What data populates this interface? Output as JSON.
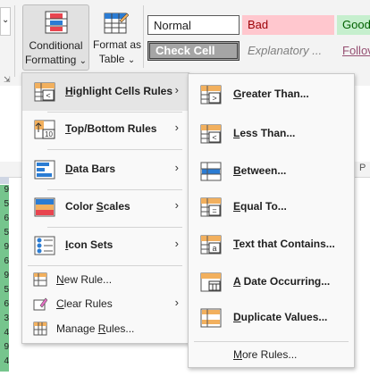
{
  "ribbon": {
    "conditional_formatting": {
      "line1": "Conditional",
      "line2": "Formatting",
      "arrow": "⌄"
    },
    "format_as_table": {
      "line1": "Format as",
      "line2": "Table",
      "arrow": "⌄"
    },
    "styles": {
      "normal": "Normal",
      "bad": "Bad",
      "good": "Good",
      "check_cell": "Check Cell",
      "explanatory": "Explanatory ...",
      "follow": "Follov"
    }
  },
  "sheet": {
    "row_values": [
      "9",
      "5",
      "6",
      "5",
      "9",
      "6",
      "9",
      "5",
      "6",
      "3",
      "4",
      "9",
      "4"
    ],
    "col_header_fragment": "P"
  },
  "main_menu": {
    "items": [
      {
        "prefix": "",
        "key": "H",
        "rest": "ighlight Cells Rules",
        "icon": "highlight-cells-rules-icon",
        "submenu": true
      },
      {
        "prefix": "",
        "key": "T",
        "rest": "op/Bottom Rules",
        "icon": "top-bottom-rules-icon",
        "submenu": true
      },
      {
        "prefix": "",
        "key": "D",
        "rest": "ata Bars",
        "icon": "data-bars-icon",
        "submenu": true
      },
      {
        "prefix": "Color ",
        "key": "S",
        "rest": "cales",
        "icon": "color-scales-icon",
        "submenu": true
      },
      {
        "prefix": "",
        "key": "I",
        "rest": "con Sets",
        "icon": "icon-sets-icon",
        "submenu": true
      }
    ],
    "small_items": [
      {
        "prefix": "",
        "key": "N",
        "rest": "ew Rule...",
        "icon": "new-rule-icon",
        "submenu": false
      },
      {
        "prefix": "",
        "key": "C",
        "rest": "lear Rules",
        "icon": "clear-rules-icon",
        "submenu": true
      },
      {
        "prefix": "Manage ",
        "key": "R",
        "rest": "ules...",
        "icon": "manage-rules-icon",
        "submenu": false
      }
    ],
    "arrow": "›"
  },
  "sub_menu": {
    "items": [
      {
        "prefix": "",
        "key": "G",
        "rest": "reater Than...",
        "icon": "greater-than-icon",
        "glyph": ">"
      },
      {
        "prefix": "",
        "key": "L",
        "rest": "ess Than...",
        "icon": "less-than-icon",
        "glyph": "<"
      },
      {
        "prefix": "",
        "key": "B",
        "rest": "etween...",
        "icon": "between-icon",
        "glyph": ""
      },
      {
        "prefix": "",
        "key": "E",
        "rest": "qual To...",
        "icon": "equal-to-icon",
        "glyph": "="
      },
      {
        "prefix": "",
        "key": "T",
        "rest": "ext that Contains...",
        "icon": "text-contains-icon",
        "glyph": "a"
      },
      {
        "prefix": "",
        "key": "A",
        "rest": " Date Occurring...",
        "icon": "date-occurring-icon",
        "glyph": ""
      },
      {
        "prefix": "",
        "key": "D",
        "rest": "uplicate Values...",
        "icon": "duplicate-values-icon",
        "glyph": ""
      }
    ],
    "more_rules": {
      "prefix": "",
      "key": "M",
      "rest": "ore Rules..."
    }
  },
  "colors": {
    "bad_bg": "#ffc7ce",
    "bad_fg": "#9c0006",
    "good_bg": "#c6efce",
    "good_fg": "#006100",
    "check_bg": "#a5a5a5",
    "accent_blue": "#2b7cd3",
    "accent_red": "#e8454f",
    "accent_orange": "#f2b05e"
  }
}
